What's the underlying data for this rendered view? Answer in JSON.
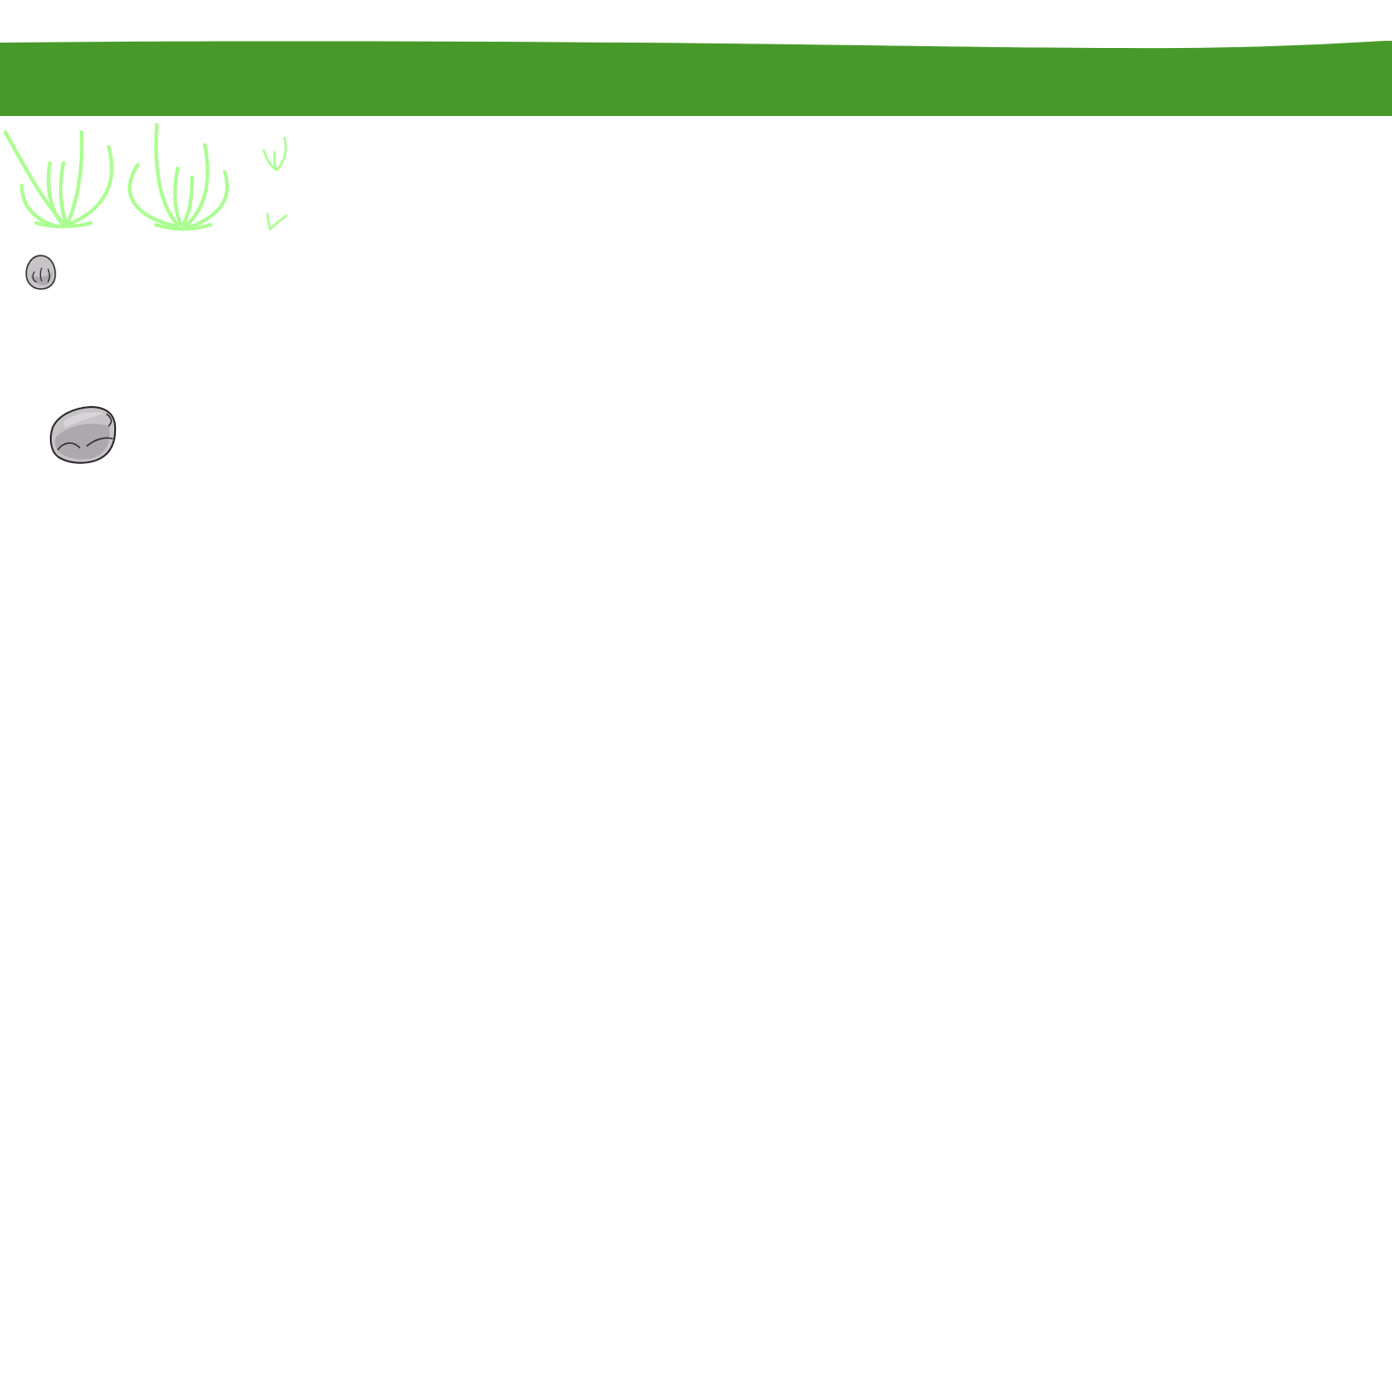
{
  "scene": {
    "type": "sprite-sheet",
    "background": "#ffffff"
  },
  "colors": {
    "ground_strip": "#479a29",
    "grass_blade": "#aaff90",
    "rock_fill": "#c7c3c7",
    "rock_shade": "#ada8ad",
    "rock_outline": "#2b2b2b"
  },
  "sprites": [
    {
      "name": "ground-strip"
    },
    {
      "name": "grass-tuft-large"
    },
    {
      "name": "grass-tuft-medium"
    },
    {
      "name": "grass-sprig-small"
    },
    {
      "name": "grass-sprig-tiny"
    },
    {
      "name": "pebble-small"
    },
    {
      "name": "rock-medium"
    }
  ]
}
